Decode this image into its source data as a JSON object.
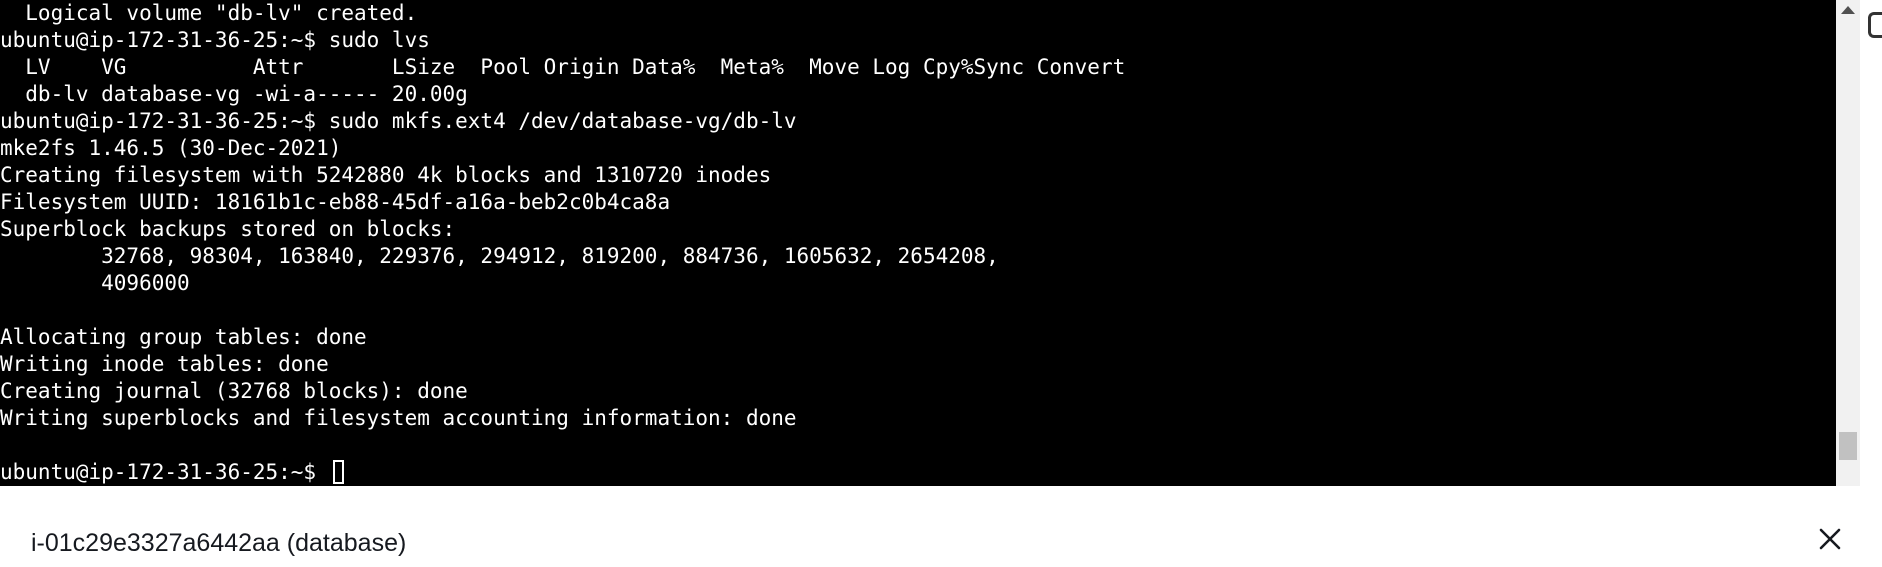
{
  "terminal": {
    "lines": [
      "  Logical volume \"db-lv\" created.",
      "ubuntu@ip-172-31-36-25:~$ sudo lvs",
      "  LV    VG          Attr       LSize  Pool Origin Data%  Meta%  Move Log Cpy%Sync Convert",
      "  db-lv database-vg -wi-a----- 20.00g",
      "ubuntu@ip-172-31-36-25:~$ sudo mkfs.ext4 /dev/database-vg/db-lv",
      "mke2fs 1.46.5 (30-Dec-2021)",
      "Creating filesystem with 5242880 4k blocks and 1310720 inodes",
      "Filesystem UUID: 18161b1c-eb88-45df-a16a-beb2c0b4ca8a",
      "Superblock backups stored on blocks:",
      "        32768, 98304, 163840, 229376, 294912, 819200, 884736, 1605632, 2654208,",
      "        4096000",
      "",
      "Allocating group tables: done",
      "Writing inode tables: done",
      "Creating journal (32768 blocks): done",
      "Writing superblocks and filesystem accounting information: done",
      "",
      "ubuntu@ip-172-31-36-25:~$ "
    ]
  },
  "instance_bar": {
    "label": "i-01c29e3327a6442aa (database)",
    "close_icon": "close-icon"
  },
  "colors": {
    "terminal_background": "#000000",
    "terminal_text": "#ffffff",
    "panel_background": "#ffffff",
    "panel_text": "#16191f"
  }
}
